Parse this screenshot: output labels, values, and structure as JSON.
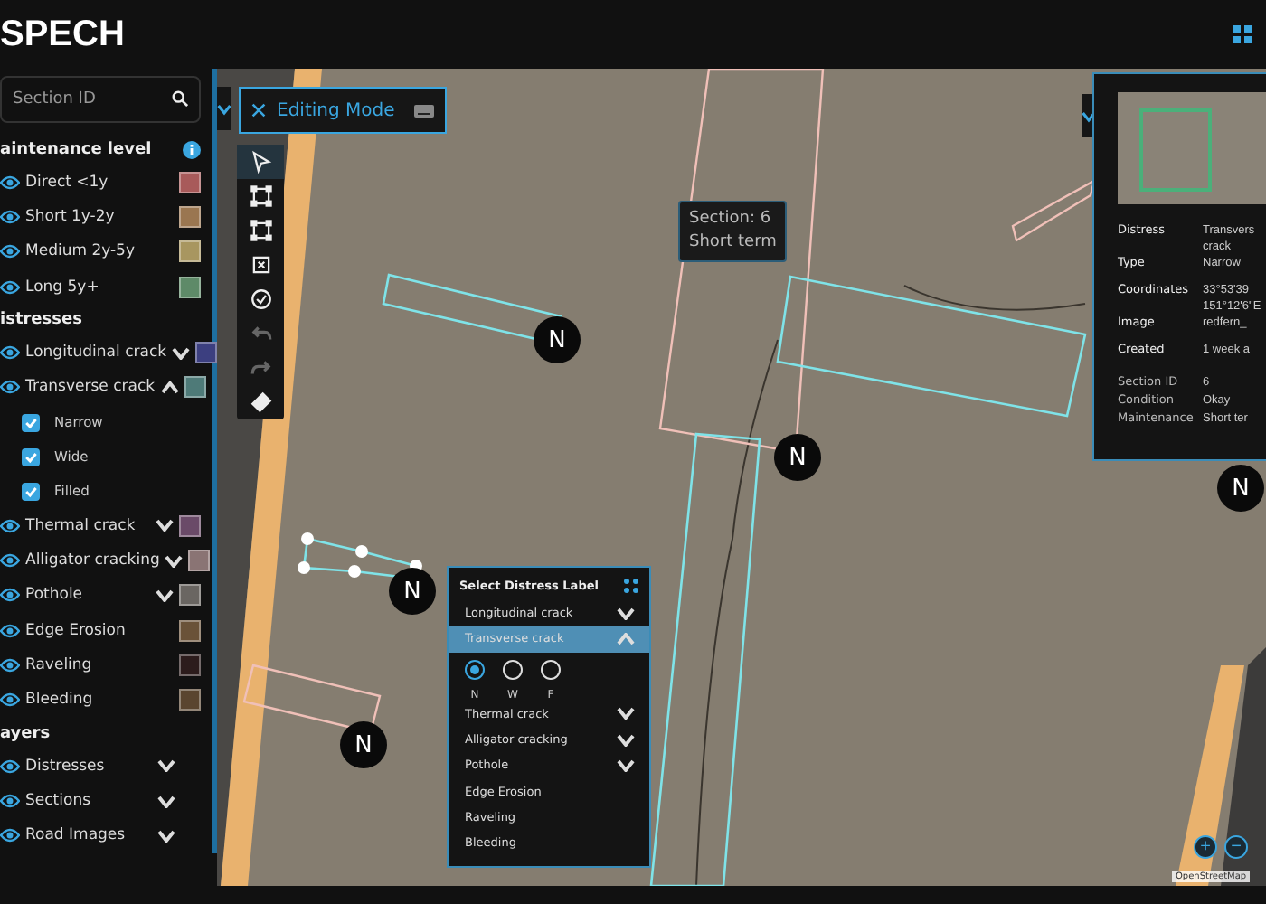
{
  "header": {
    "logo": "SPECH"
  },
  "sidebar": {
    "search": {
      "placeholder": "Section ID"
    },
    "maintenance": {
      "title": "aintenance level",
      "items": [
        {
          "label": "Direct <1y",
          "color": "#a85a5a",
          "visible": true
        },
        {
          "label": "Short 1y-2y",
          "color": "#9a7650",
          "visible": true
        },
        {
          "label": "Medium 2y-5y",
          "color": "#a89660",
          "visible": true
        },
        {
          "label": "Long 5y+",
          "color": "#5e8a68",
          "visible": true
        }
      ]
    },
    "distresses": {
      "title": "istresses",
      "items": [
        {
          "label": "Longitudinal crack",
          "color": "#3c3f80",
          "visible": true,
          "expandable": true,
          "expanded": false
        },
        {
          "label": "Transverse crack",
          "color": "#4e7a78",
          "visible": true,
          "expandable": true,
          "expanded": true,
          "children": [
            {
              "label": "Narrow",
              "checked": true
            },
            {
              "label": "Wide",
              "checked": true
            },
            {
              "label": "Filled",
              "checked": true
            }
          ]
        },
        {
          "label": "Thermal crack",
          "color": "#6a4a68",
          "visible": true,
          "expandable": true,
          "expanded": false
        },
        {
          "label": "Alligator cracking",
          "color": "#8a7474",
          "visible": true,
          "expandable": true,
          "expanded": false
        },
        {
          "label": "Pothole",
          "color": "#6a6662",
          "visible": true,
          "expandable": true,
          "expanded": false
        },
        {
          "label": "Edge Erosion",
          "color": "#6a5238",
          "visible": true,
          "expandable": false
        },
        {
          "label": "Raveling",
          "color": "#2c1c1c",
          "visible": true,
          "expandable": false
        },
        {
          "label": "Bleeding",
          "color": "#5a4530",
          "visible": true,
          "expandable": false
        }
      ]
    },
    "layers": {
      "title": "ayers",
      "items": [
        {
          "label": "Distresses",
          "visible": true,
          "expanded": false
        },
        {
          "label": "Sections",
          "visible": true,
          "expanded": false
        },
        {
          "label": "Road Images",
          "visible": true,
          "expanded": false
        }
      ]
    }
  },
  "map": {
    "editing_mode": {
      "title": "Editing Mode"
    },
    "tools": [
      {
        "kind": "select",
        "selected": true,
        "disabled": false
      },
      {
        "kind": "rectangle",
        "selected": false,
        "disabled": false
      },
      {
        "kind": "corners",
        "selected": false,
        "disabled": false
      },
      {
        "kind": "transform",
        "selected": false,
        "disabled": false
      },
      {
        "kind": "check",
        "selected": false,
        "disabled": false
      },
      {
        "kind": "undo",
        "selected": false,
        "disabled": true
      },
      {
        "kind": "redo",
        "selected": false,
        "disabled": true
      },
      {
        "kind": "eraser",
        "selected": false,
        "disabled": false
      }
    ],
    "tooltip": {
      "lines": [
        "Section: 6",
        "Short term"
      ]
    },
    "markers": [
      {
        "label": "N"
      },
      {
        "label": "N"
      },
      {
        "label": "N"
      },
      {
        "label": "N"
      },
      {
        "label": "N"
      }
    ],
    "label_picker": {
      "title": "Select Distress Label",
      "options": [
        {
          "label": "Longitudinal crack",
          "expandable": true,
          "selected": false
        },
        {
          "label": "Transverse crack",
          "expandable": true,
          "selected": true,
          "sub_options": [
            {
              "label": "N",
              "selected": true
            },
            {
              "label": "W",
              "selected": false
            },
            {
              "label": "F",
              "selected": false
            }
          ]
        },
        {
          "label": "Thermal crack",
          "expandable": true,
          "selected": false
        },
        {
          "label": "Alligator cracking",
          "expandable": true,
          "selected": false
        },
        {
          "label": "Pothole",
          "expandable": true,
          "selected": false
        },
        {
          "label": "Edge Erosion",
          "expandable": false,
          "selected": false
        },
        {
          "label": "Raveling",
          "expandable": false,
          "selected": false
        },
        {
          "label": "Bleeding",
          "expandable": false,
          "selected": false
        }
      ]
    },
    "info_panel": {
      "rows": [
        {
          "label": "Distress",
          "value": "Transvers crack"
        },
        {
          "label": "Type",
          "value": "Narrow"
        },
        {
          "label": "Coordinates",
          "value": "33°53'39 151°12'6\"E"
        },
        {
          "label": "Image",
          "value": "redfern_"
        },
        {
          "label": "Created",
          "value": "1 week a"
        }
      ],
      "meta_rows": [
        {
          "label": "Section ID",
          "value": "6"
        },
        {
          "label": "Condition",
          "value": "Okay"
        },
        {
          "label": "Maintenance",
          "value": "Short ter"
        }
      ]
    },
    "zoom": {
      "in": "+",
      "out": "−"
    },
    "attribution": "OpenStreetMap"
  }
}
